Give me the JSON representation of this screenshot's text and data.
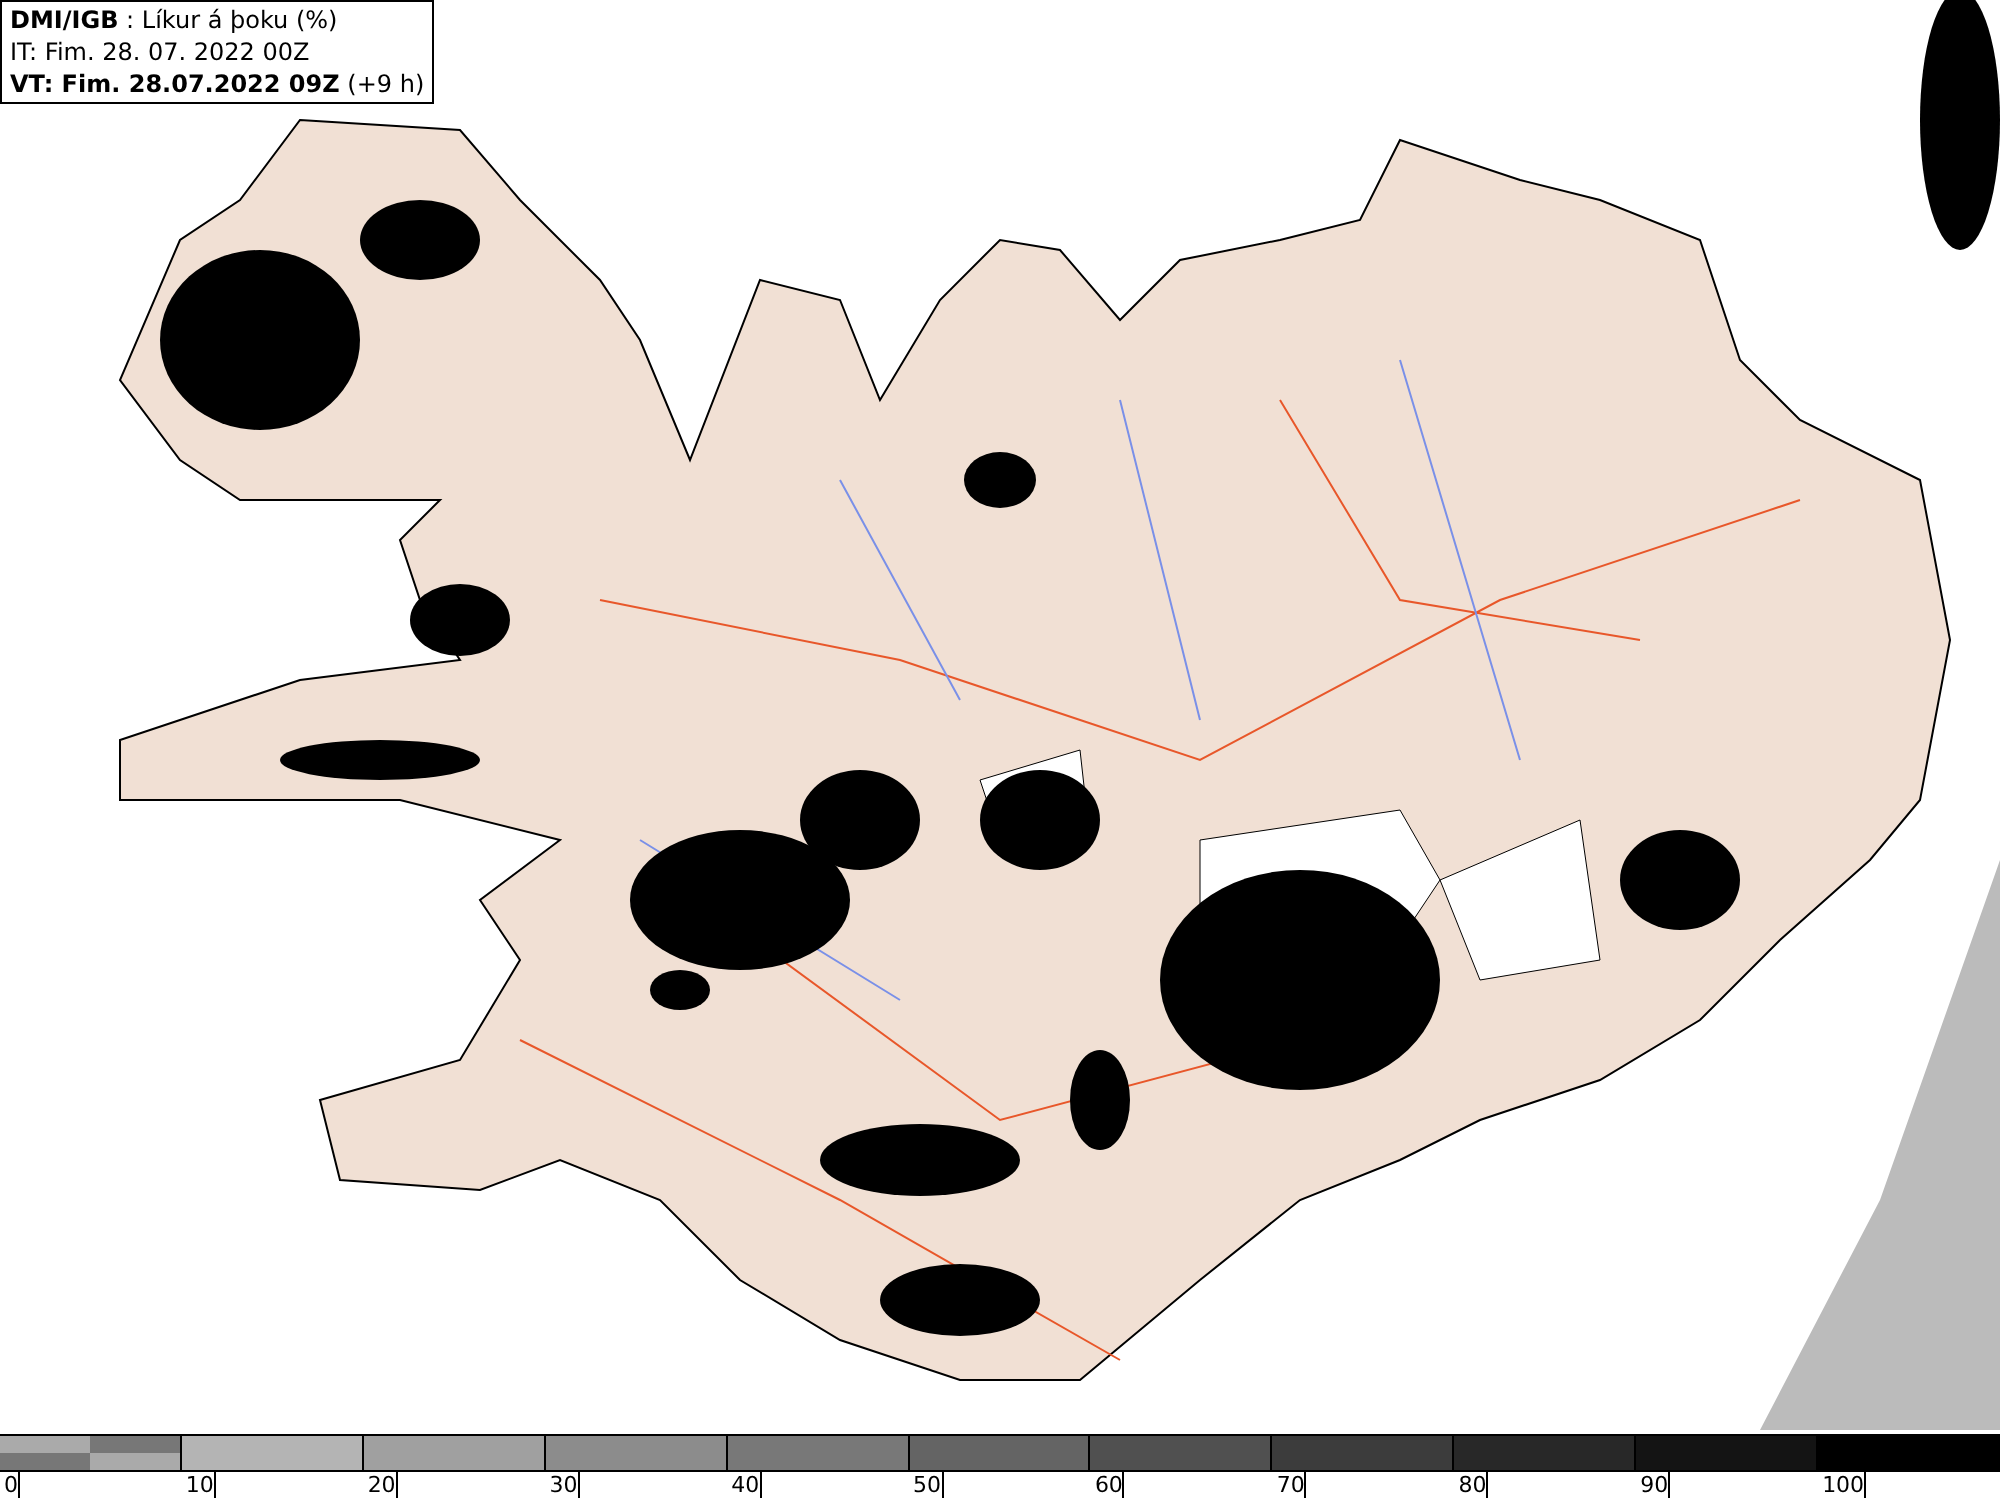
{
  "header": {
    "lines": [
      "**DMI/IGB** : Líkur á þoku (%)",
      "IT: Fim. 28. 07. 2022 00Z",
      "**VT: Fim. 28.07.2022 09Z** (+9 h)"
    ]
  },
  "legend": [
    {
      "label": "0",
      "kind": "checker"
    },
    {
      "label": "10",
      "kind": "solid",
      "color": "#b4b4b4"
    },
    {
      "label": "20",
      "kind": "solid",
      "color": "#a0a0a0"
    },
    {
      "label": "30",
      "kind": "solid",
      "color": "#8c8c8c"
    },
    {
      "label": "40",
      "kind": "solid",
      "color": "#787878"
    },
    {
      "label": "50",
      "kind": "solid",
      "color": "#646464"
    },
    {
      "label": "60",
      "kind": "solid",
      "color": "#505050"
    },
    {
      "label": "70",
      "kind": "solid",
      "color": "#3c3c3c"
    },
    {
      "label": "80",
      "kind": "solid",
      "color": "#282828"
    },
    {
      "label": "90",
      "kind": "solid",
      "color": "#141414"
    },
    {
      "label": "100",
      "kind": "solid",
      "color": "#000000"
    }
  ]
}
